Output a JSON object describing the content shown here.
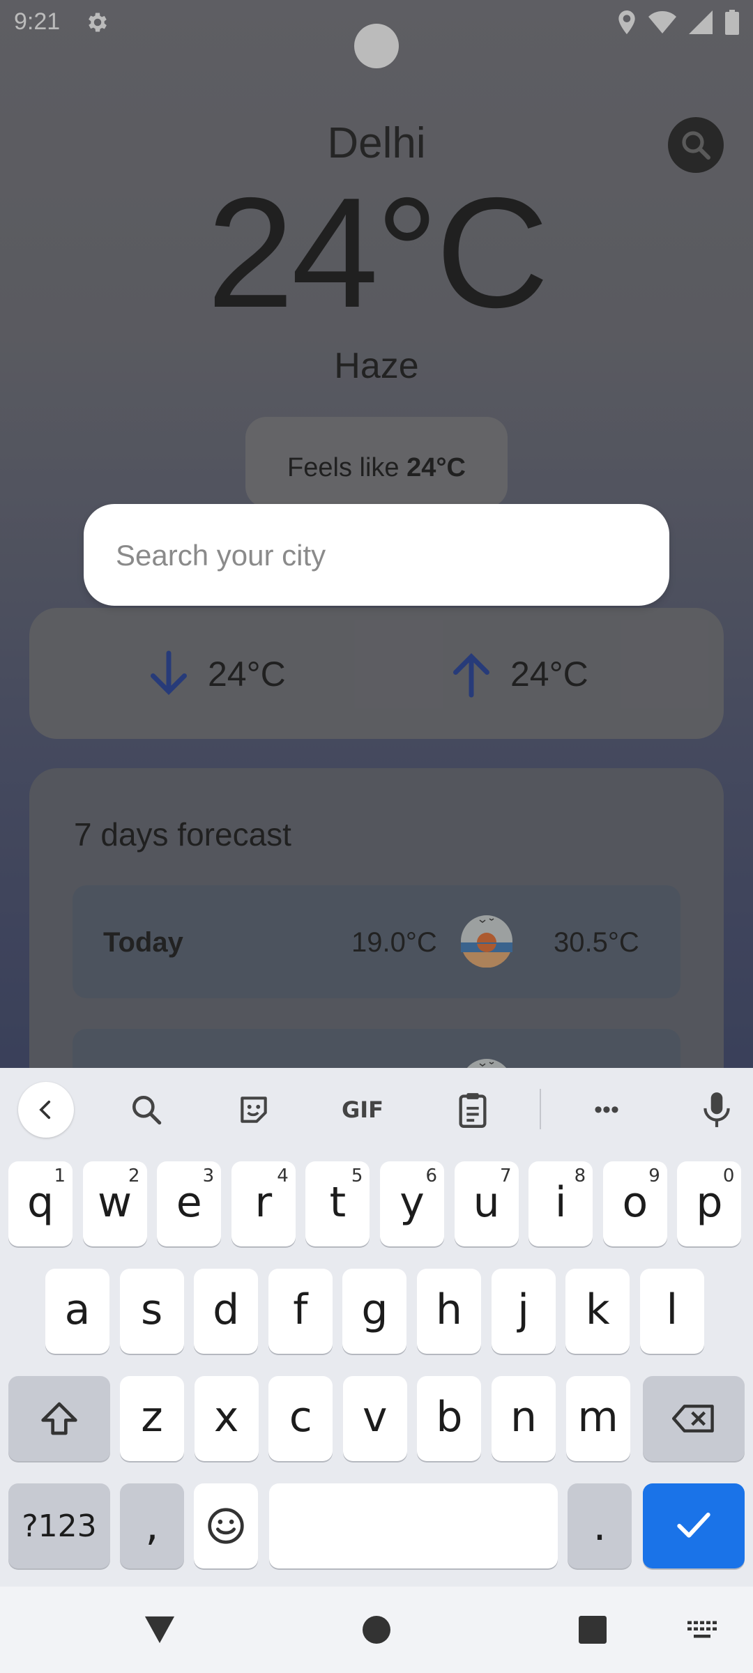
{
  "status_bar": {
    "time": "9:21"
  },
  "weather": {
    "city": "Delhi",
    "temperature": "24°C",
    "condition": "Haze",
    "feels_like_label": "Feels like ",
    "feels_like_value": "24°C",
    "min_temp": "24°C",
    "max_temp": "24°C"
  },
  "search": {
    "placeholder": "Search your city",
    "value": ""
  },
  "forecast": {
    "title": "7 days forecast",
    "rows": [
      {
        "day": "Today",
        "low": "19.0°C",
        "high": "30.5°C",
        "icon": "sunset-icon"
      }
    ]
  },
  "keyboard": {
    "toolbar": {
      "gif_label": "GIF",
      "more": "•••"
    },
    "row1": [
      {
        "k": "q",
        "n": "1"
      },
      {
        "k": "w",
        "n": "2"
      },
      {
        "k": "e",
        "n": "3"
      },
      {
        "k": "r",
        "n": "4"
      },
      {
        "k": "t",
        "n": "5"
      },
      {
        "k": "y",
        "n": "6"
      },
      {
        "k": "u",
        "n": "7"
      },
      {
        "k": "i",
        "n": "8"
      },
      {
        "k": "o",
        "n": "9"
      },
      {
        "k": "p",
        "n": "0"
      }
    ],
    "row2": [
      "a",
      "s",
      "d",
      "f",
      "g",
      "h",
      "j",
      "k",
      "l"
    ],
    "row3": [
      "z",
      "x",
      "c",
      "v",
      "b",
      "n",
      "m"
    ],
    "symbols_label": "?123",
    "comma": ",",
    "period": "."
  }
}
